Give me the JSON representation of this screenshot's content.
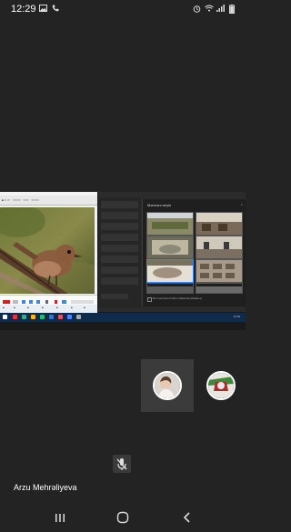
{
  "status_bar": {
    "time": "12:29",
    "battery": "",
    "icons": [
      "gallery-icon",
      "phone-icon",
      "alarm-icon",
      "wifi-icon",
      "signal-icon",
      "battery-icon"
    ]
  },
  "shared_screen": {
    "panel_title": "Mənzərə seçin",
    "panel_checkbox_label": "Bu mənzərəni bütün iclaslarda istifadə et",
    "taskbar_tray_time": "12:39"
  },
  "participants": {
    "active_user_name": "Arzu Mehrəliyeva"
  },
  "controls": {
    "mic_muted": true
  },
  "colors": {
    "background": "#232323",
    "tile_active": "#3b3b3b",
    "taskbar": "#0f2a4a"
  }
}
